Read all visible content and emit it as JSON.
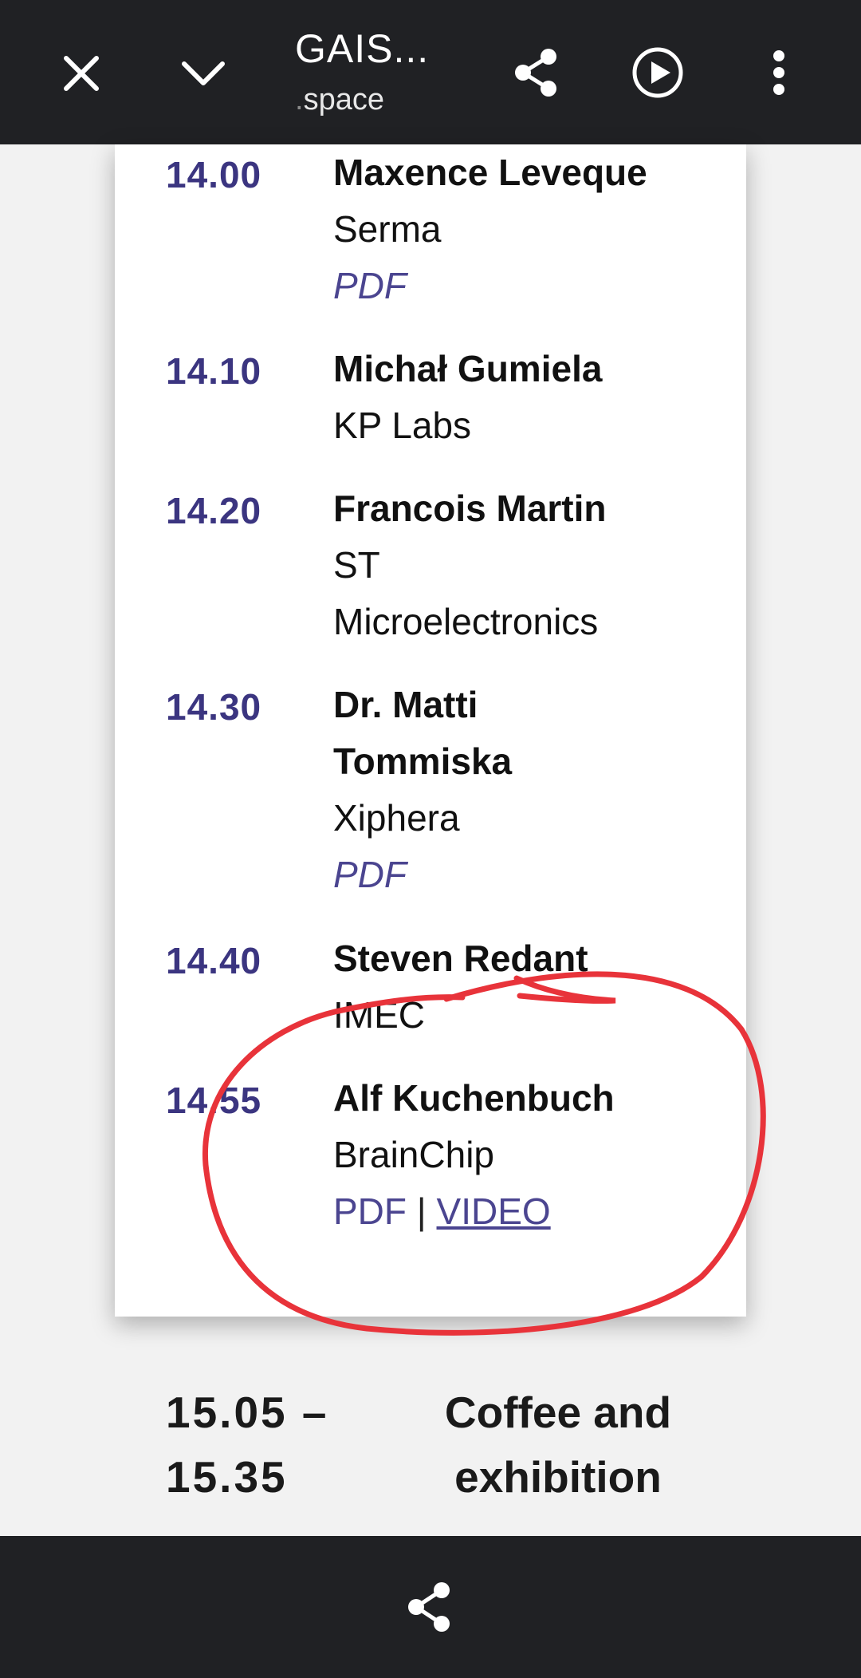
{
  "topbar": {
    "title": "GAIS...",
    "subtitle_dim": ".",
    "subtitle": "space",
    "icons": [
      "close-icon",
      "chevron-down-icon",
      "share-icon",
      "play-circle-icon",
      "more-vert-icon"
    ]
  },
  "schedule": [
    {
      "time": "14.00",
      "name_lines": [
        "Maxence Leveque"
      ],
      "org_lines": [
        "Serma"
      ],
      "pdf": "PDF"
    },
    {
      "time": "14.10",
      "name_lines": [
        "Michał Gumiela"
      ],
      "org_lines": [
        "KP Labs"
      ]
    },
    {
      "time": "14.20",
      "name_lines": [
        "Francois Martin"
      ],
      "org_lines": [
        "ST",
        "Microelectronics"
      ]
    },
    {
      "time": "14.30",
      "name_lines": [
        "Dr. Matti",
        "Tommiska"
      ],
      "org_lines": [
        "Xiphera"
      ],
      "pdf": "PDF"
    },
    {
      "time": "14.40",
      "name_lines": [
        "Steven Redant"
      ],
      "org_lines": [
        "IMEC"
      ]
    },
    {
      "time": "14.55",
      "name_lines": [
        "Alf Kuchenbuch"
      ],
      "org_lines": [
        "BrainChip"
      ],
      "pdf": "PDF",
      "separator": "|",
      "video": "VIDEO"
    }
  ],
  "break": {
    "time_line1": "15.05 –",
    "time_line2": "15.35",
    "label_line1": "Coffee and",
    "label_line2": "exhibition"
  },
  "bottombar": {
    "icon": "share-icon"
  },
  "colors": {
    "bar": "#202124",
    "accent": "#3b3580",
    "annotation": "#e8333a"
  }
}
